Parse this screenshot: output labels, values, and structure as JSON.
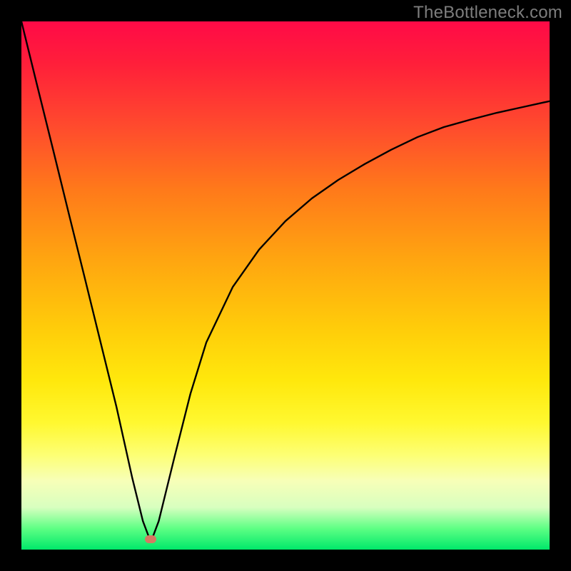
{
  "watermark": "TheBottleneck.com",
  "colors": {
    "frame_border": "#000000",
    "curve": "#000000",
    "dot": "#d57a62"
  },
  "dot": {
    "x_frac": 0.245,
    "y_frac": 0.98
  },
  "chart_data": {
    "type": "line",
    "title": "",
    "xlabel": "",
    "ylabel": "",
    "xlim": [
      0,
      1
    ],
    "ylim": [
      0,
      1
    ],
    "note": "No axes or tick labels are shown; data is read as approximate normalized (x,y) positions within the plot frame. y≈1 is the top of the frame. The curve dips from the upper-left to a minimum near x≈0.245 and rises back toward the upper-right.",
    "series": [
      {
        "name": "curve",
        "x": [
          0.0,
          0.03,
          0.06,
          0.09,
          0.12,
          0.15,
          0.18,
          0.21,
          0.23,
          0.245,
          0.26,
          0.29,
          0.32,
          0.35,
          0.4,
          0.45,
          0.5,
          0.55,
          0.6,
          0.65,
          0.7,
          0.75,
          0.8,
          0.85,
          0.9,
          0.95,
          1.0
        ],
        "values": [
          1.0,
          0.878,
          0.757,
          0.635,
          0.514,
          0.392,
          0.27,
          0.135,
          0.054,
          0.014,
          0.054,
          0.176,
          0.295,
          0.392,
          0.497,
          0.568,
          0.622,
          0.665,
          0.7,
          0.73,
          0.757,
          0.781,
          0.8,
          0.814,
          0.827,
          0.838,
          0.849
        ]
      }
    ],
    "marker": {
      "x": 0.245,
      "y": 0.014,
      "label": ""
    }
  }
}
